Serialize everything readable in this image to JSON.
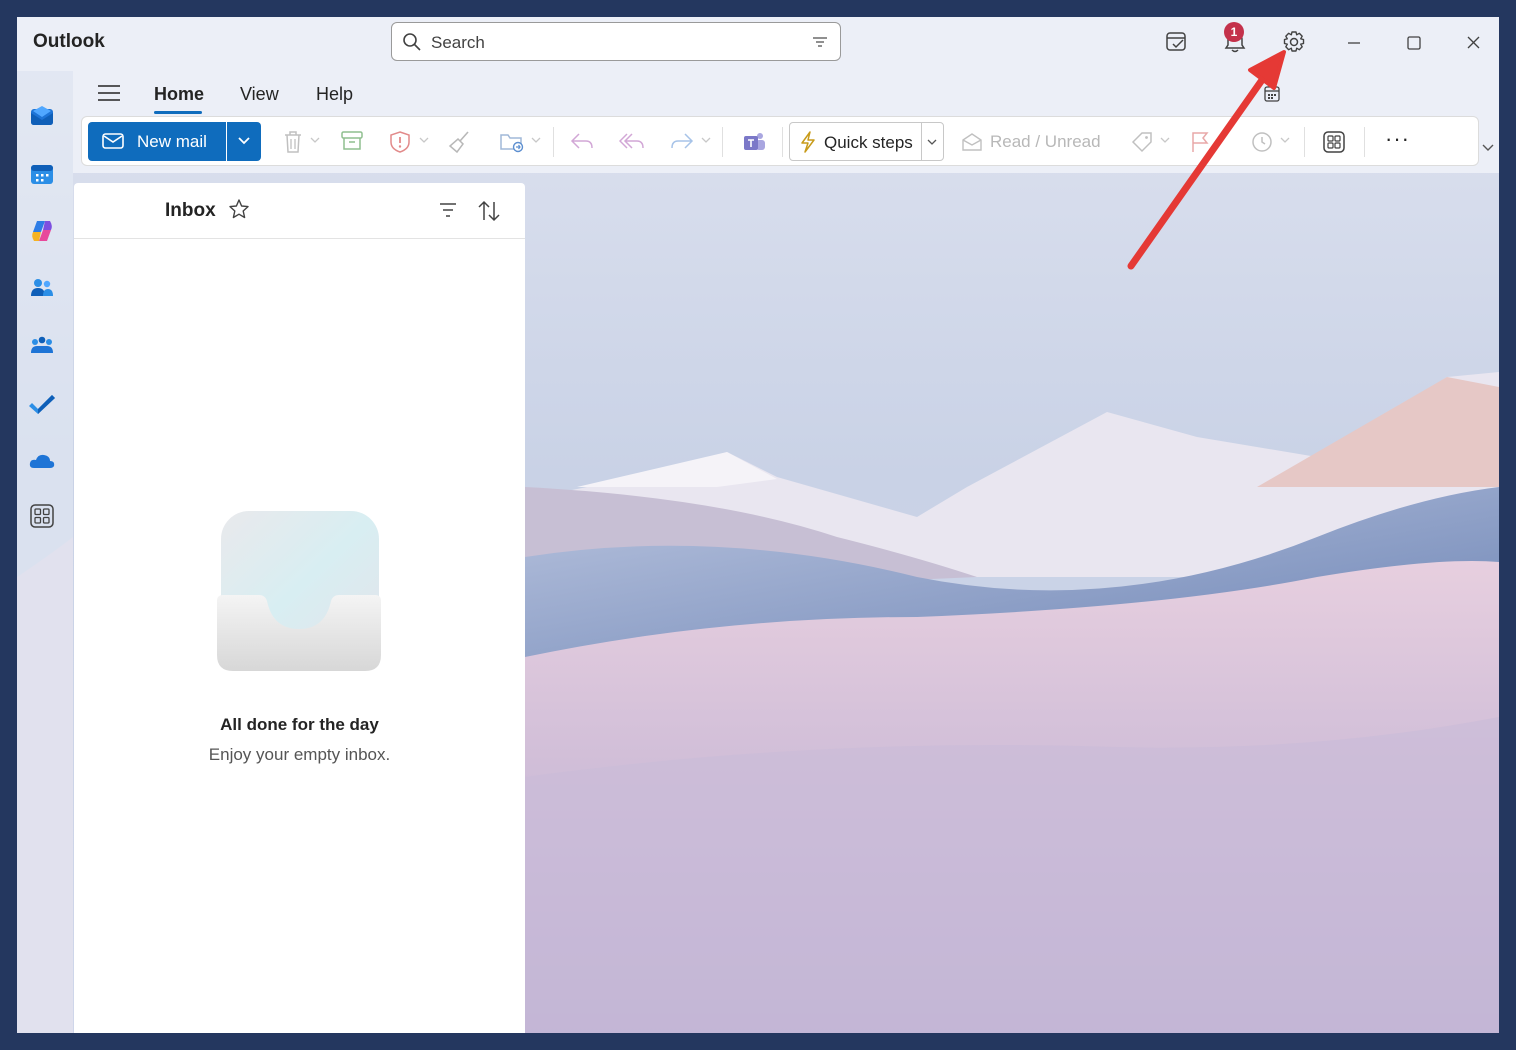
{
  "app": {
    "title": "Outlook"
  },
  "search": {
    "placeholder": "Search"
  },
  "titlebar": {
    "notification_count": "1"
  },
  "tabs": [
    {
      "label": "Home",
      "active": true
    },
    {
      "label": "View",
      "active": false
    },
    {
      "label": "Help",
      "active": false
    }
  ],
  "ribbon": {
    "new_mail_label": "New mail",
    "quick_steps_label": "Quick steps",
    "read_unread_label": "Read / Unread",
    "more_label": "···"
  },
  "inbox": {
    "title": "Inbox",
    "empty_title": "All done for the day",
    "empty_subtitle": "Enjoy your empty inbox."
  },
  "colors": {
    "accent": "#0f6cbd",
    "badge": "#c4314b",
    "annotation_arrow": "#e53935",
    "frame": "#24375f"
  },
  "icons": {
    "rail": [
      "mail-icon",
      "calendar-icon",
      "copilot-icon",
      "people-icon",
      "groups-icon",
      "todo-icon",
      "onedrive-icon",
      "apps-icon"
    ],
    "titlebar": [
      "my-day-icon",
      "bell-icon",
      "gear-icon",
      "minimize-icon",
      "maximize-icon",
      "close-icon"
    ]
  }
}
